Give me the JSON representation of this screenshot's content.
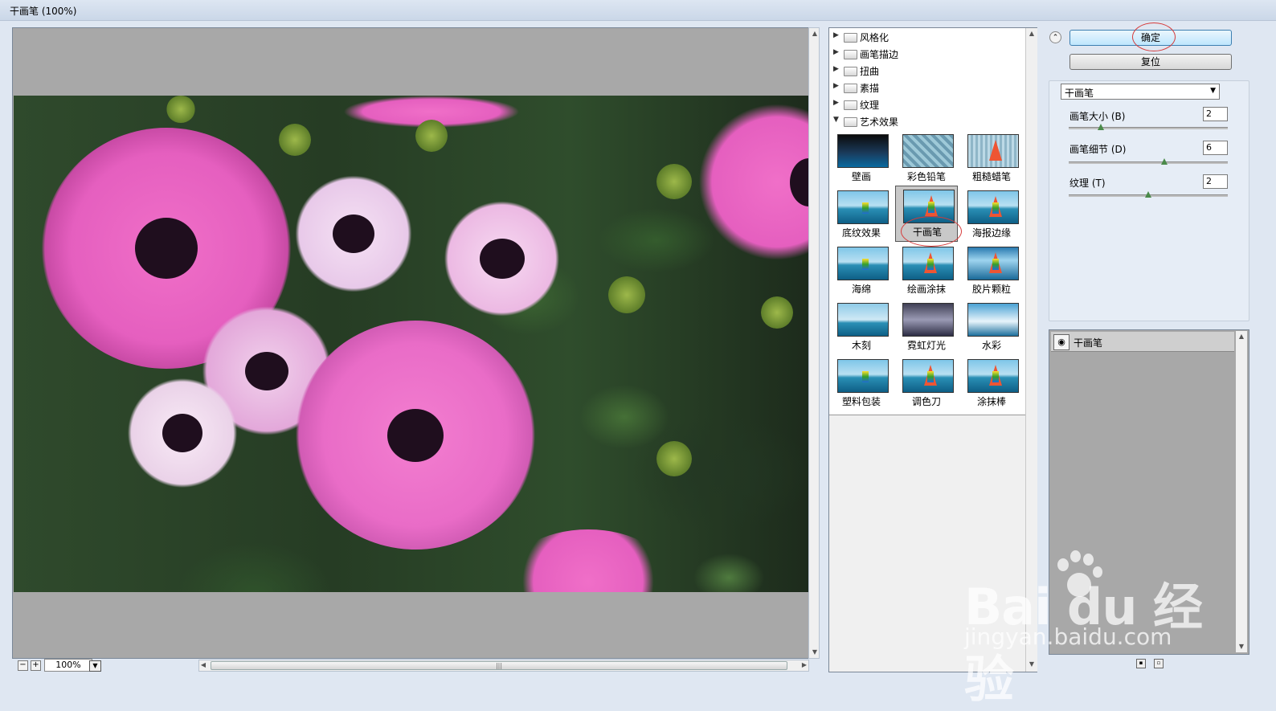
{
  "window": {
    "title": "干画笔 (100%)"
  },
  "preview": {
    "zoom": "100%"
  },
  "filter_list": {
    "categories": [
      "风格化",
      "画笔描边",
      "扭曲",
      "素描",
      "纹理",
      "艺术效果"
    ],
    "expanded": "艺术效果",
    "thumbnails": [
      "壁画",
      "彩色铅笔",
      "粗糙蜡笔",
      "底纹效果",
      "干画笔",
      "海报边缘",
      "海绵",
      "绘画涂抹",
      "胶片颗粒",
      "木刻",
      "霓虹灯光",
      "水彩",
      "塑料包装",
      "调色刀",
      "涂抹棒"
    ],
    "selected": "干画笔"
  },
  "buttons": {
    "ok": "确定",
    "reset": "复位"
  },
  "settings": {
    "filter_select": "干画笔",
    "params": [
      {
        "label": "画笔大小 (B)",
        "value": "2",
        "level": 0.2
      },
      {
        "label": "画笔细节 (D)",
        "value": "6",
        "level": 0.6
      },
      {
        "label": "纹理 (T)",
        "value": "2",
        "level": 0.5
      }
    ]
  },
  "layers": {
    "items": [
      "干画笔"
    ]
  },
  "watermark": {
    "logo": "Bai du 经验",
    "url": "jingyan.baidu.com"
  },
  "colors": {
    "accent": "#3c7fb1",
    "highlight_ring": "#d63a3a",
    "panel_bg": "#dfe7f2"
  }
}
